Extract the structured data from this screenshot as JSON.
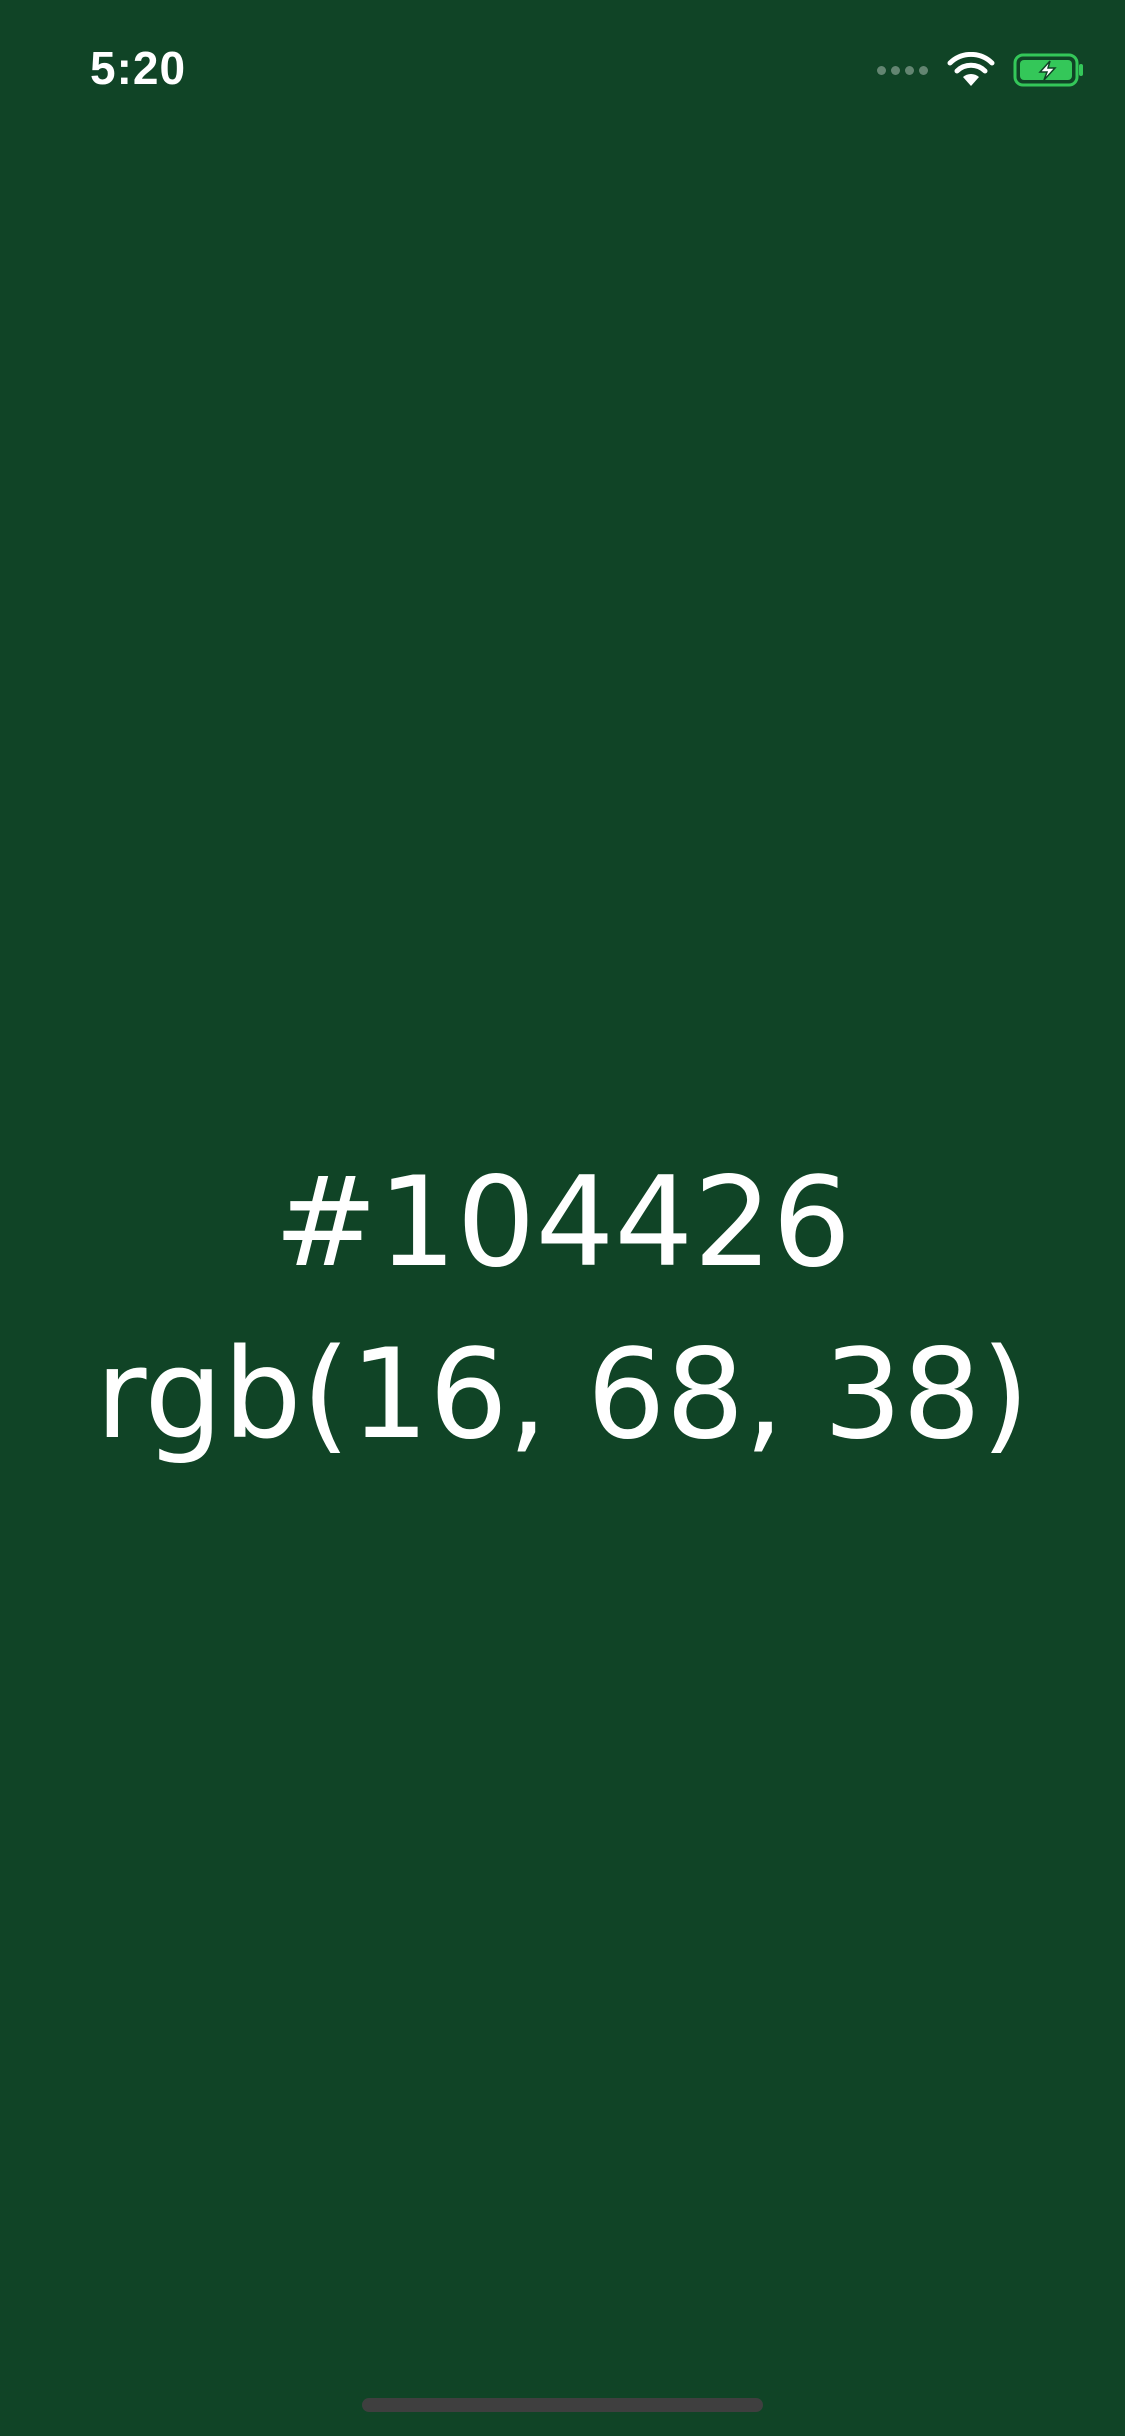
{
  "status_bar": {
    "time": "5:20",
    "icons": [
      "cellular-signal-icon",
      "wifi-icon",
      "battery-charging-icon"
    ],
    "battery_color": "#34c759"
  },
  "color": {
    "hex": "#104426",
    "rgb": "rgb(16, 68, 38)",
    "background": "#104426",
    "text_color": "#ffffff"
  }
}
